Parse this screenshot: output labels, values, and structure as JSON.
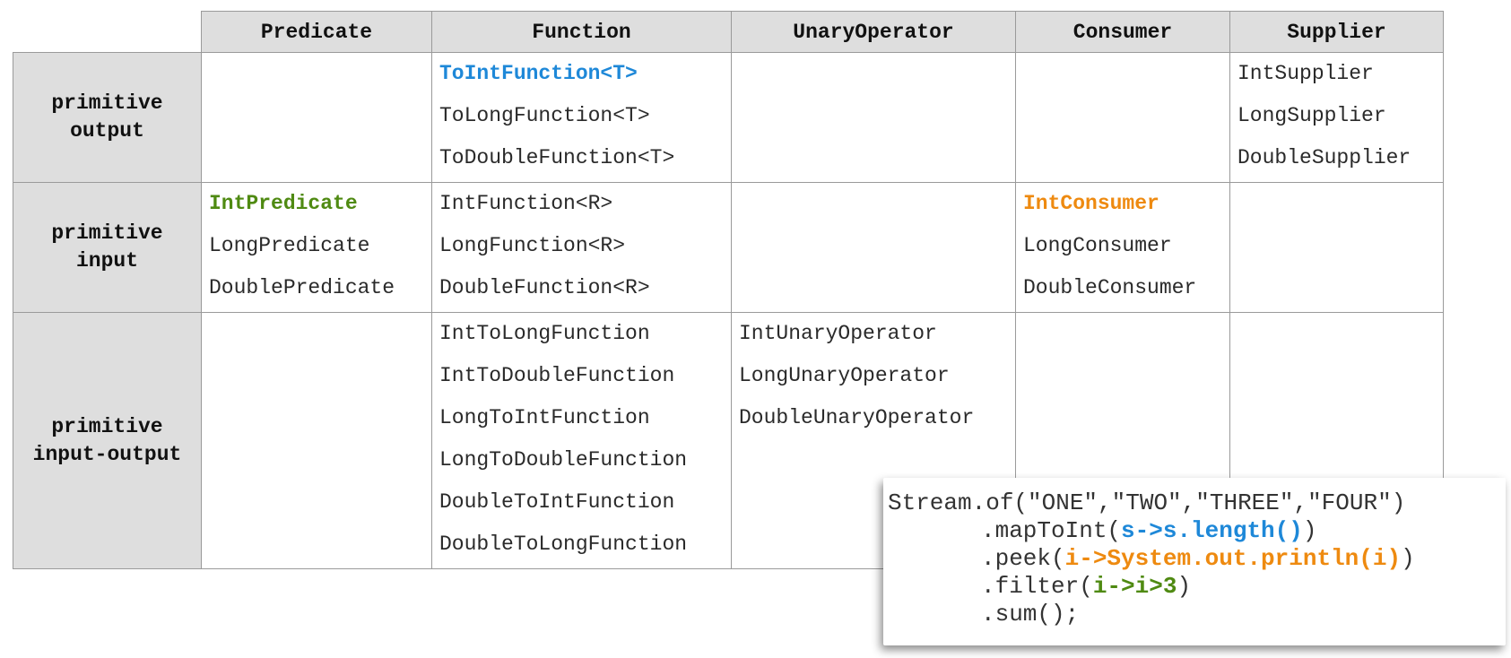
{
  "table": {
    "columns": [
      "Predicate",
      "Function",
      "UnaryOperator",
      "Consumer",
      "Supplier"
    ],
    "rows": [
      {
        "label_lines": [
          "primitive",
          "output"
        ],
        "cells": [
          [],
          [
            "ToIntFunction<T>",
            "ToLongFunction<T>",
            "ToDoubleFunction<T>"
          ],
          [],
          [],
          [
            "IntSupplier",
            "LongSupplier",
            "DoubleSupplier"
          ]
        ]
      },
      {
        "label_lines": [
          "primitive",
          "input"
        ],
        "cells": [
          [
            "IntPredicate",
            "LongPredicate",
            "DoublePredicate"
          ],
          [
            "IntFunction<R>",
            "LongFunction<R>",
            "DoubleFunction<R>"
          ],
          [],
          [
            "IntConsumer",
            "LongConsumer",
            "DoubleConsumer"
          ],
          []
        ]
      },
      {
        "label_lines": [
          "primitive",
          "input-output"
        ],
        "cells": [
          [],
          [
            "IntToLongFunction",
            "IntToDoubleFunction",
            "LongToIntFunction",
            "LongToDoubleFunction",
            "DoubleToIntFunction",
            "DoubleToLongFunction"
          ],
          [
            "IntUnaryOperator",
            "LongUnaryOperator",
            "DoubleUnaryOperator"
          ],
          [],
          []
        ]
      }
    ]
  },
  "highlights": {
    "ToIntFunction<T>": "blue",
    "IntPredicate": "green",
    "IntConsumer": "orange"
  },
  "code": {
    "line1": "Stream.of(\"ONE\",\"TWO\",\"THREE\",\"FOUR\")",
    "line2_prefix": ".mapToInt(",
    "line2_expr": "s->s.length()",
    "line2_suffix": ")",
    "line3_prefix": ".peek(",
    "line3_expr": "i->System.out.println(i)",
    "line3_suffix": ")",
    "line4_prefix": ".filter(",
    "line4_expr": "i->i>3",
    "line4_suffix": ")",
    "line5": ".sum();"
  },
  "colors": {
    "blue": "#1e88d8",
    "green": "#4f8a12",
    "orange": "#ee8a10",
    "header_bg": "#dedede"
  }
}
